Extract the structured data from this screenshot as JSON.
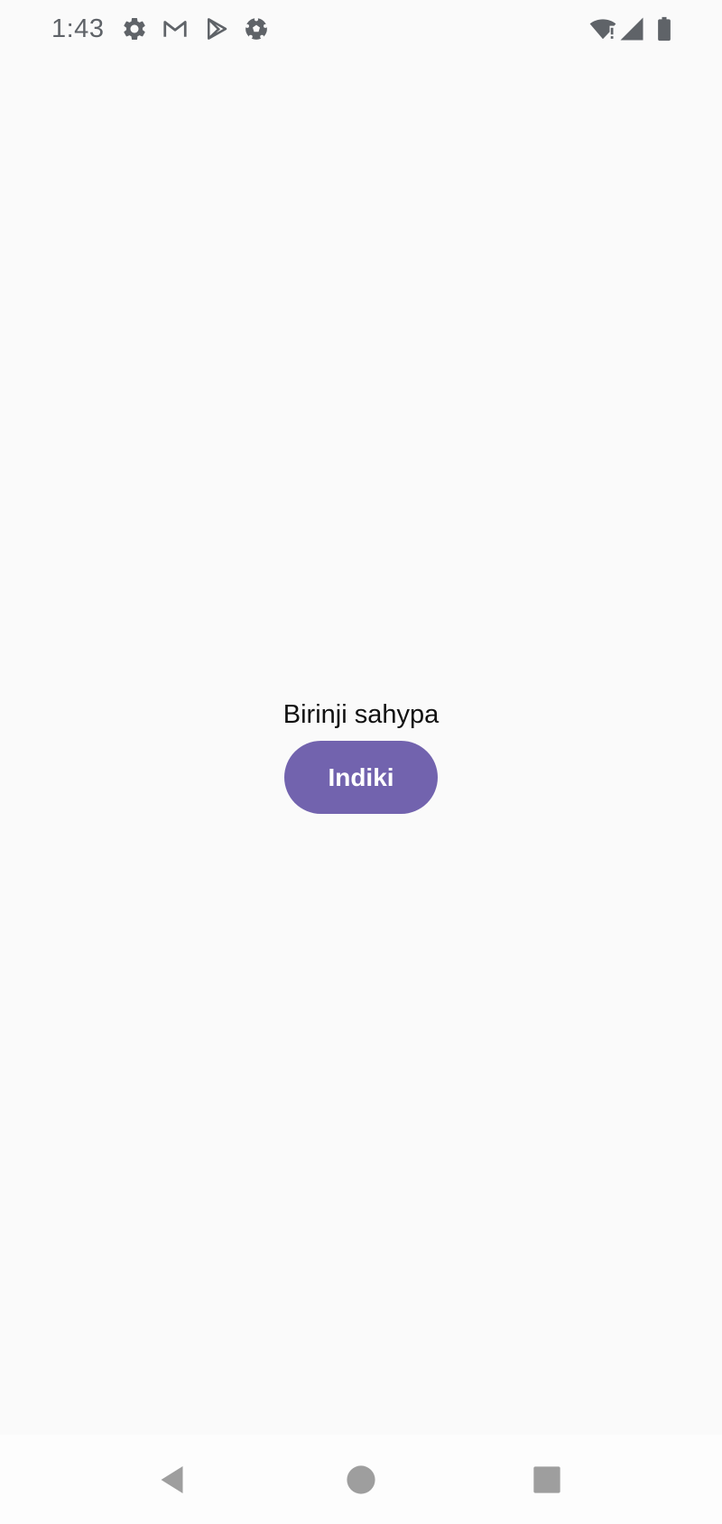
{
  "status_bar": {
    "time": "1:43",
    "notification_icons": [
      "settings-icon",
      "gmail-icon",
      "play-store-icon",
      "soccer-ball-icon"
    ],
    "system_icons": [
      "wifi-alert-icon",
      "cell-signal-icon",
      "battery-icon"
    ]
  },
  "main": {
    "title": "Birinji sahypa",
    "button_label": "Indiki"
  },
  "nav_bar": {
    "buttons": [
      "back-icon",
      "home-icon",
      "recents-icon"
    ]
  },
  "colors": {
    "background": "#fafafa",
    "button": "#7263ae",
    "status_icon": "#5f6368",
    "nav_icon": "#9e9e9e"
  }
}
